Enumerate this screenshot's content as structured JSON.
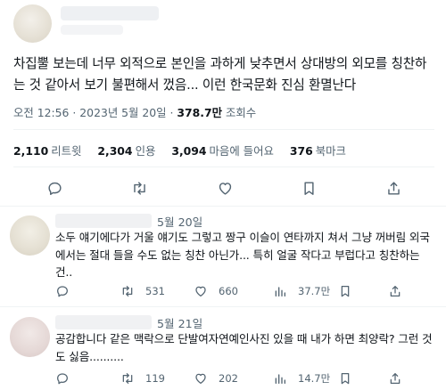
{
  "tweet": {
    "text": "차집뿔 보는데 너무 외적으로 본인을 과하게 낮추면서 상대방의 외모를 칭찬하는 것 같아서 보기 불편해서 껐음... 이런 한국문화 진심 환멸난다",
    "time": "오전 12:56",
    "date": "2023년 5월 20일",
    "views_count": "378.7만",
    "views_label": "조회수",
    "stats": [
      {
        "count": "2,110",
        "label": "리트윗"
      },
      {
        "count": "2,304",
        "label": "인용"
      },
      {
        "count": "3,094",
        "label": "마음에 들어요"
      },
      {
        "count": "376",
        "label": "북마크"
      }
    ],
    "icons": [
      "reply-icon",
      "retweet-icon",
      "like-icon",
      "bookmark-icon",
      "share-icon"
    ]
  },
  "replies": [
    {
      "date": "5월 20일",
      "text": "소두 얘기에다가 거울 얘기도 그렇고 짱구 이슬이 연타까지 쳐서 그냥 꺼버림 외국에서는 절대 들을 수도 없는 칭찬 아닌가... 특히 얼굴 작다고 부럽다고 칭찬하는 건..",
      "retweets": "531",
      "likes": "660",
      "views": "37.7만"
    },
    {
      "date": "5월 21일",
      "text": "공감합니다 같은 맥락으로 단발여자연예인사진 있을 때 내가 하면 최양락? 그런 것도 싫음..........",
      "retweets": "119",
      "likes": "202",
      "views": "14.7만"
    }
  ],
  "colors": {
    "text": "#0f1419",
    "muted": "#536471",
    "divider": "#eff3f4",
    "icon": "#536471"
  }
}
